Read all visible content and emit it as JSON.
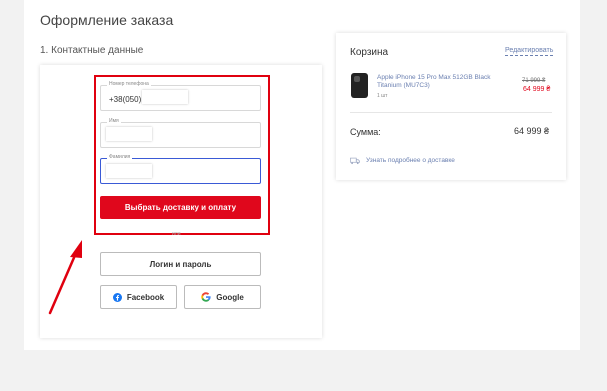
{
  "page": {
    "title": "Оформление заказа",
    "section": "1. Контактные данные"
  },
  "form": {
    "phone": {
      "label": "Номер телефона",
      "value": "+38(050)"
    },
    "name": {
      "label": "Имя"
    },
    "surname": {
      "label": "Фамилия"
    },
    "submit_label": "Выбрать доставку и оплату",
    "or_label": "или",
    "login_label": "Логин и пароль",
    "facebook_label": "Facebook",
    "google_label": "Google"
  },
  "cart": {
    "title": "Корзина",
    "edit_label": "Редактировать",
    "product": {
      "name": "Apple iPhone 15 Pro Max 512GB Black Titanium (MU7C3)",
      "qty": "1 шт",
      "old_price": "71 999 ₴",
      "price": "64 999 ₴"
    },
    "sum_label": "Сумма:",
    "sum_value": "64 999 ₴",
    "delivery_link": "Узнать подробнее о доставке"
  },
  "colors": {
    "accent_red": "#e0071c",
    "link_blue": "#6a7fb0",
    "annotation_red": "#e0000f"
  }
}
